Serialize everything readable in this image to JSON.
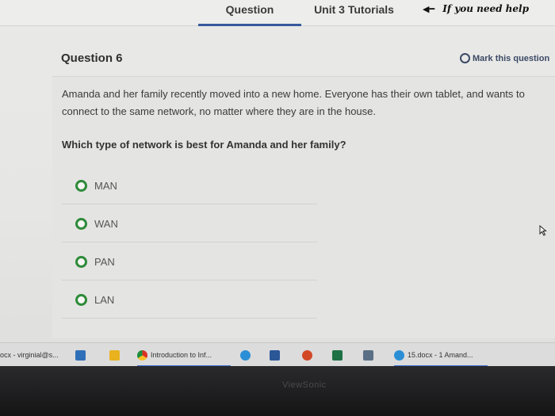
{
  "tabs": {
    "question": "Question",
    "tutorials": "Unit 3 Tutorials"
  },
  "help_note": "If you need help",
  "question": {
    "title": "Question 6",
    "mark_label": "Mark this question",
    "body": "Amanda and her family recently moved into a new home. Everyone has their own tablet, and wants to connect to the same network, no matter where they are in the house.",
    "prompt": "Which type of network is best for Amanda and her family?",
    "options": [
      "MAN",
      "WAN",
      "PAN",
      "LAN"
    ]
  },
  "taskbar": {
    "left_label": "ocx - virginial@s...",
    "chrome_label": "Introduction to Inf...",
    "doc_label": "15.docx - 1 Amand..."
  },
  "monitor_brand": "ViewSonic",
  "colors": {
    "accent": "#355b9c",
    "radio": "#2e8b3a"
  }
}
